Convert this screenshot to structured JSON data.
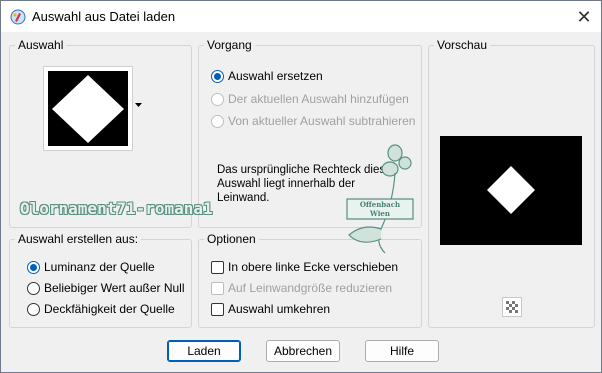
{
  "window": {
    "title": "Auswahl aus Datei laden",
    "close_glyph": "✕"
  },
  "selection_group": {
    "legend": "Auswahl"
  },
  "operation_group": {
    "legend": "Vorgang",
    "options": [
      {
        "label": "Auswahl ersetzen",
        "checked": true,
        "enabled": true
      },
      {
        "label": "Der aktuellen Auswahl hinzufügen",
        "checked": false,
        "enabled": false
      },
      {
        "label": "Von aktueller Auswahl subtrahieren",
        "checked": false,
        "enabled": false
      }
    ],
    "info_text": "Das ursprüngliche Rechteck dieser Auswahl liegt innerhalb der Leinwand."
  },
  "preview_group": {
    "legend": "Vorschau"
  },
  "create_from_group": {
    "legend": "Auswahl erstellen aus:",
    "options": [
      {
        "label": "Luminanz der Quelle",
        "checked": true
      },
      {
        "label": "Beliebiger Wert außer Null",
        "checked": false
      },
      {
        "label": "Deckfähigkeit der Quelle",
        "checked": false
      }
    ]
  },
  "options_group": {
    "legend": "Optionen",
    "checkboxes": [
      {
        "label": "In obere linke Ecke verschieben",
        "checked": false,
        "enabled": true
      },
      {
        "label": "Auf Leinwandgröße reduzieren",
        "checked": false,
        "enabled": false
      },
      {
        "label": "Auswahl umkehren",
        "checked": false,
        "enabled": true
      }
    ]
  },
  "buttons": {
    "load": "Laden",
    "cancel": "Abbrechen",
    "help": "Hilfe"
  },
  "watermark": {
    "text": "Olornament71-romana1",
    "stamp_line1": "Offenbach",
    "stamp_line2": "Wien"
  },
  "colors": {
    "accent": "#005fb8",
    "watermark": "#5a8f83"
  },
  "icons": {
    "app": "paint-shop-icon",
    "dropdown": "dropdown-arrow-icon",
    "transparency": "checkerboard-icon"
  }
}
